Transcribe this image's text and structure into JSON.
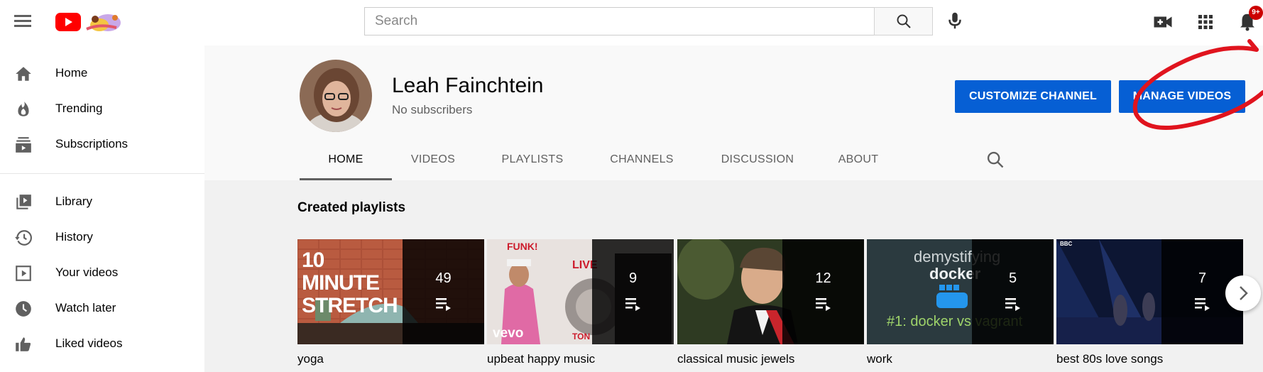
{
  "header": {
    "search_placeholder": "Search",
    "notification_count": "9+"
  },
  "sidebar": {
    "items": [
      {
        "label": "Home",
        "icon": "home-icon"
      },
      {
        "label": "Trending",
        "icon": "trending-icon"
      },
      {
        "label": "Subscriptions",
        "icon": "subscriptions-icon"
      },
      {
        "label": "Library",
        "icon": "library-icon"
      },
      {
        "label": "History",
        "icon": "history-icon"
      },
      {
        "label": "Your videos",
        "icon": "your-videos-icon"
      },
      {
        "label": "Watch later",
        "icon": "watch-later-icon"
      },
      {
        "label": "Liked videos",
        "icon": "liked-videos-icon"
      }
    ]
  },
  "channel": {
    "name": "Leah Fainchtein",
    "subscribers": "No subscribers",
    "customize_label": "CUSTOMIZE CHANNEL",
    "manage_label": "MANAGE VIDEOS",
    "tabs": [
      "HOME",
      "VIDEOS",
      "PLAYLISTS",
      "CHANNELS",
      "DISCUSSION",
      "ABOUT"
    ],
    "active_tab": "HOME"
  },
  "content": {
    "section_title": "Created playlists",
    "playlists": [
      {
        "title": "yoga",
        "count": "49",
        "thumb_text": [
          "10 MINUTE",
          "STRETCH"
        ]
      },
      {
        "title": "upbeat happy music",
        "count": "9",
        "thumb_text": [
          "FUNK!",
          "LIVE",
          "vevo",
          "TON"
        ]
      },
      {
        "title": "classical music jewels",
        "count": "12",
        "thumb_text": []
      },
      {
        "title": "work",
        "count": "5",
        "thumb_text": [
          "demystifying",
          "docker",
          "#1: docker vs vagrant"
        ]
      },
      {
        "title": "best 80s love songs",
        "count": "7",
        "thumb_text": [
          "BBC"
        ]
      }
    ]
  },
  "colors": {
    "brand_red": "#ff0000",
    "button_blue": "#065fd4",
    "annotation_red": "#e0141e"
  }
}
